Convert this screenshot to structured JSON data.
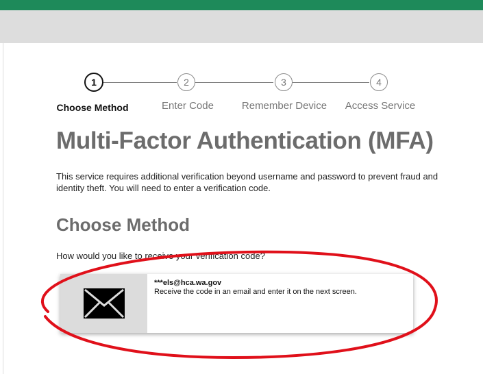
{
  "colors": {
    "accent": "#1e8a5a",
    "header_gray": "#dddddd",
    "heading_gray": "#6c6c6c",
    "annotation_red": "#e0101a"
  },
  "stepper": {
    "steps": [
      {
        "number": "1",
        "label": "Choose Method",
        "active": true
      },
      {
        "number": "2",
        "label": "Enter Code",
        "active": false
      },
      {
        "number": "3",
        "label": "Remember Device",
        "active": false
      },
      {
        "number": "4",
        "label": "Access Service",
        "active": false
      }
    ]
  },
  "main": {
    "title": "Multi-Factor Authentication (MFA)",
    "intro": "This service requires additional verification beyond username and password to prevent fraud and identity theft. You will need to enter a verification code.",
    "subtitle": "Choose Method",
    "question": "How would you like to receive your verification code?"
  },
  "method": {
    "icon": "envelope-icon",
    "address": "***els@hca.wa.gov",
    "description": "Receive the code in an email and enter it on the next screen."
  }
}
